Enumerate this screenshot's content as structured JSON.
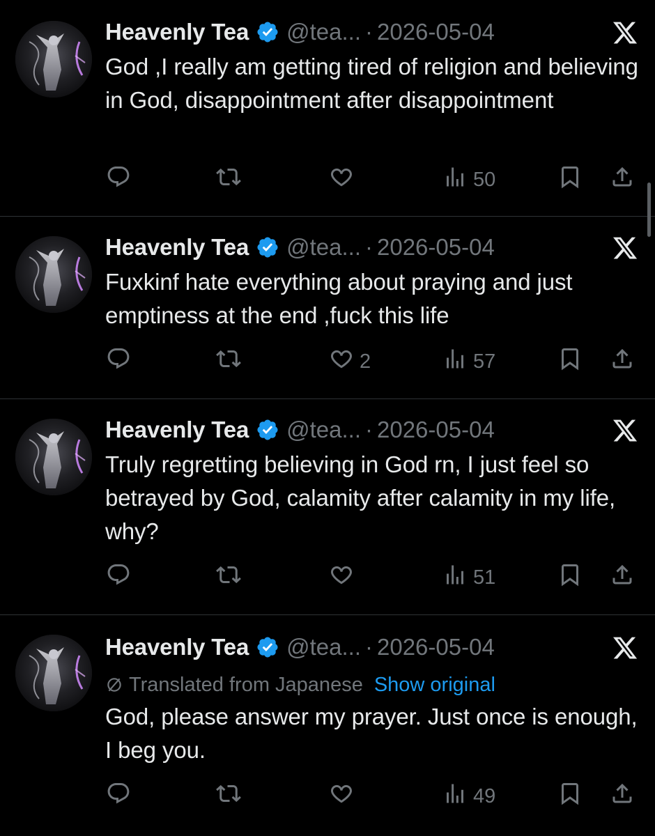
{
  "colors": {
    "background": "#000000",
    "text_primary": "#e7e9ea",
    "text_secondary": "#71767b",
    "link": "#1d9bf0",
    "verified_badge": "#1d9bf0",
    "divider": "#2f3336"
  },
  "icons": {
    "verified": "verified-badge-icon",
    "platform": "x-logo-icon",
    "reply": "reply-icon",
    "retweet": "retweet-icon",
    "like": "heart-icon",
    "views": "views-chart-icon",
    "bookmark": "bookmark-icon",
    "share": "share-icon",
    "translate": "translate-icon"
  },
  "tweets": [
    {
      "author_name": "Heavenly Tea",
      "handle": "@tea...",
      "separator": "·",
      "date": "2026-05-04",
      "text": "God ,I really am getting tired of religion and believing in God, disappointment after disappointment",
      "replies": "",
      "retweets": "",
      "likes": "",
      "views": "50"
    },
    {
      "author_name": "Heavenly Tea",
      "handle": "@tea...",
      "separator": "·",
      "date": "2026-05-04",
      "text": "Fuxkinf hate everything about praying and just emptiness at the end ,fuck this life",
      "replies": "",
      "retweets": "",
      "likes": "2",
      "views": "57"
    },
    {
      "author_name": "Heavenly Tea",
      "handle": "@tea...",
      "separator": "·",
      "date": "2026-05-04",
      "text": "Truly regretting believing in God rn, I just feel so betrayed by God, calamity after calamity in my life, why?",
      "replies": "",
      "retweets": "",
      "likes": "",
      "views": "51"
    },
    {
      "author_name": "Heavenly Tea",
      "handle": "@tea...",
      "separator": "·",
      "date": "2026-05-04",
      "translated_label": "Translated from Japanese",
      "show_original_label": "Show original",
      "text": "God, please answer my prayer. Just once is enough, I beg you.",
      "replies": "",
      "retweets": "",
      "likes": "",
      "views": "49"
    }
  ]
}
